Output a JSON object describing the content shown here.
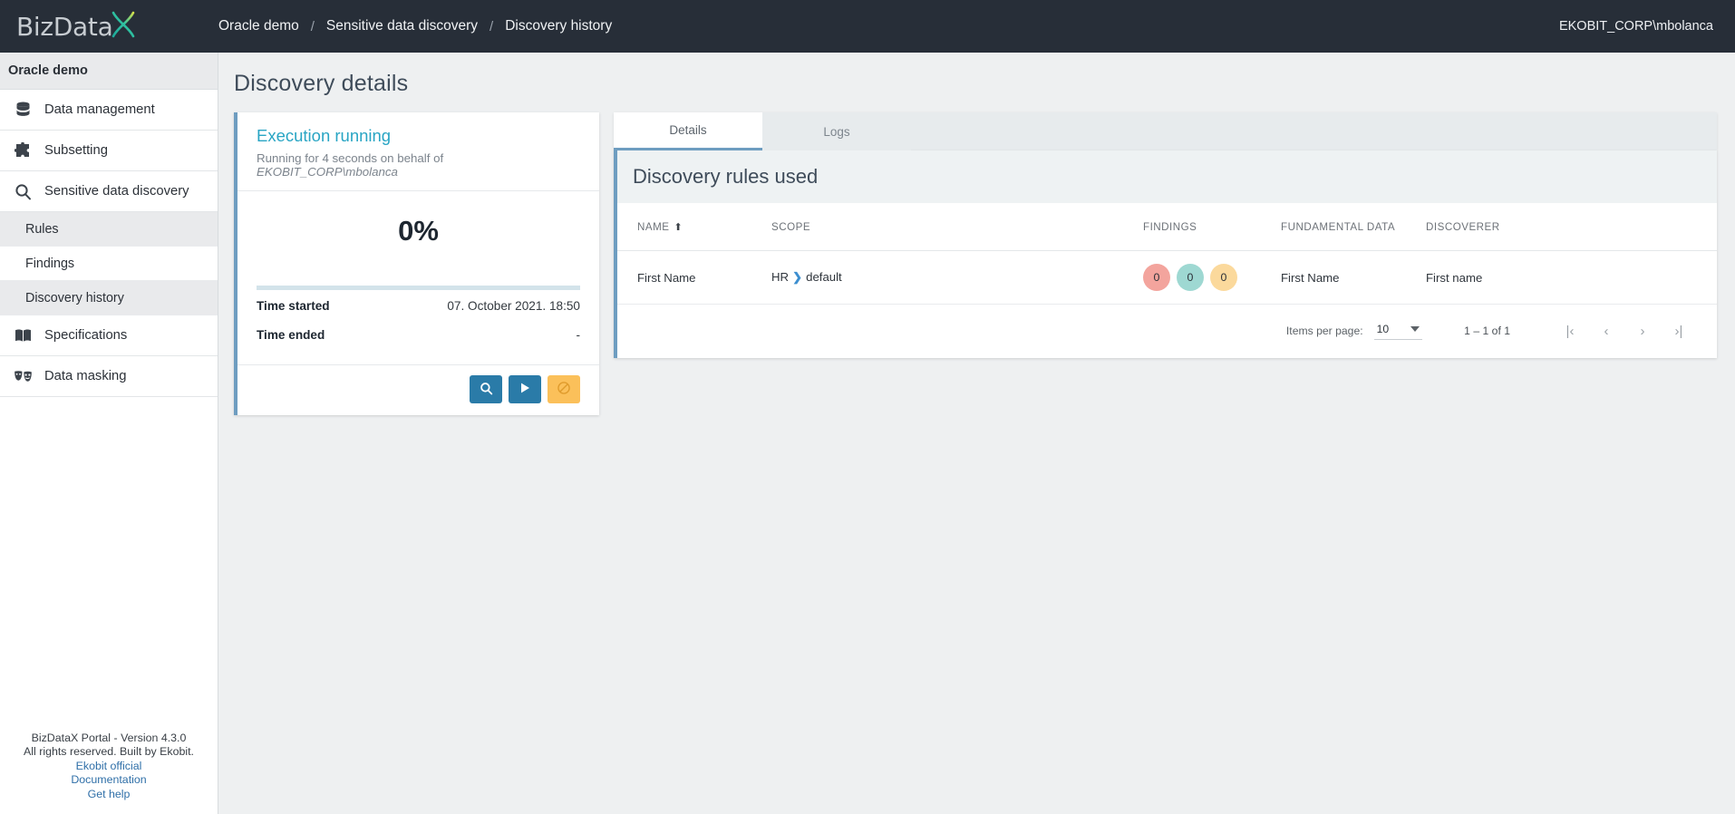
{
  "header": {
    "logo_text": "BizData",
    "logo_x": "X",
    "breadcrumb": [
      {
        "label": "Oracle demo"
      },
      {
        "label": "Sensitive data discovery"
      },
      {
        "label": "Discovery history"
      }
    ],
    "separator": "/",
    "user": "EKOBIT_CORP\\mbolanca"
  },
  "sidebar": {
    "group_title": "Oracle demo",
    "items": [
      {
        "label": "Data management",
        "icon": "database-icon"
      },
      {
        "label": "Subsetting",
        "icon": "puzzle-icon"
      },
      {
        "label": "Sensitive data discovery",
        "icon": "search-icon"
      }
    ],
    "sub_items": [
      {
        "label": "Rules",
        "active": true
      },
      {
        "label": "Findings",
        "active": false
      },
      {
        "label": "Discovery history",
        "active": true
      }
    ],
    "items_bottom": [
      {
        "label": "Specifications",
        "icon": "book-icon"
      },
      {
        "label": "Data masking",
        "icon": "masks-icon"
      }
    ],
    "footer": {
      "version": "BizDataX Portal - Version 4.3.0",
      "rights": "All rights reserved. Built by Ekobit.",
      "links": [
        "Ekobit official",
        "Documentation",
        "Get help"
      ]
    }
  },
  "main": {
    "page_title": "Discovery details",
    "execution": {
      "title": "Execution running",
      "subtitle_prefix": "Running for 4 seconds on behalf of ",
      "subtitle_user": "EKOBIT_CORP\\mbolanca",
      "percent_label": "0%",
      "percent_value": 0,
      "rows": [
        {
          "key": "Time started",
          "value": "07. October 2021. 18:50"
        },
        {
          "key": "Time ended",
          "value": "-"
        }
      ],
      "actions": [
        {
          "name": "search-button",
          "icon": "search-icon",
          "color": "#2a7ba8"
        },
        {
          "name": "run-button",
          "icon": "play-icon",
          "color": "#2a7ba8"
        },
        {
          "name": "cancel-button",
          "icon": "cancel-icon",
          "color": "#fbc05a"
        }
      ]
    },
    "tabs": [
      {
        "label": "Details",
        "active": true
      },
      {
        "label": "Logs",
        "active": false
      }
    ],
    "table": {
      "caption": "Discovery rules used",
      "columns": [
        {
          "label": "NAME",
          "sorted": true,
          "sort_dir": "asc"
        },
        {
          "label": "SCOPE"
        },
        {
          "label": "FINDINGS"
        },
        {
          "label": "FUNDAMENTAL DATA"
        },
        {
          "label": "DISCOVERER"
        }
      ],
      "rows": [
        {
          "name": "First Name",
          "scope_parent": "HR",
          "scope_sep": "❯",
          "scope_child": "default",
          "findings": [
            {
              "value": "0",
              "color": "#f3a49d"
            },
            {
              "value": "0",
              "color": "#9ed8d2"
            },
            {
              "value": "0",
              "color": "#fbd99c"
            }
          ],
          "fundamental_data": "First Name",
          "discoverer": "First name"
        }
      ],
      "paginator": {
        "items_per_page_label": "Items per page:",
        "items_per_page_value": "10",
        "range_label": "1 – 1 of 1",
        "first_label": "|‹",
        "prev_label": "‹",
        "next_label": "›",
        "last_label": "›|"
      }
    }
  },
  "colors": {
    "accent_blue": "#6e9dc0",
    "title_teal": "#29a5c4",
    "topbar_bg": "#272e38",
    "page_bg": "#eef0f1"
  }
}
